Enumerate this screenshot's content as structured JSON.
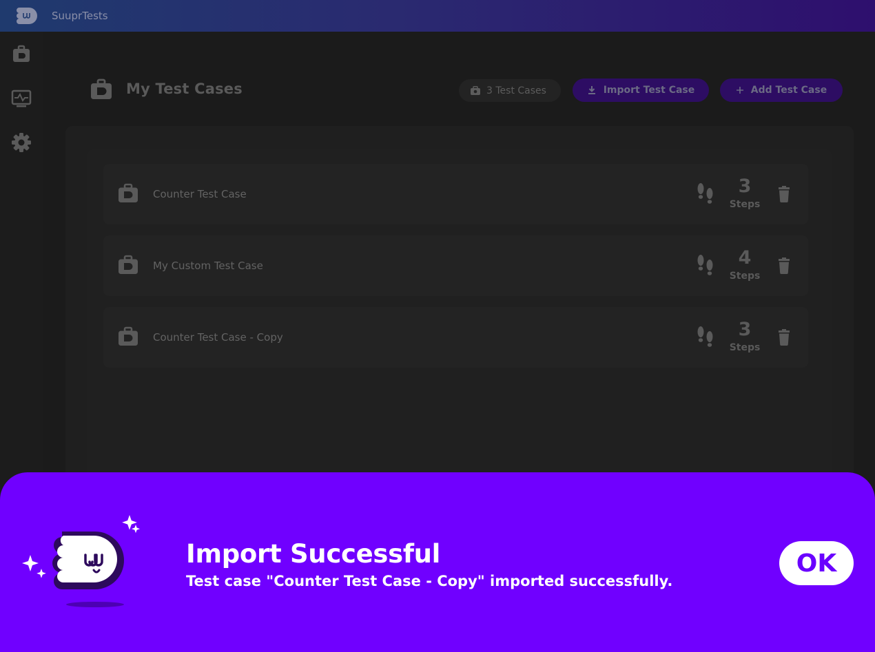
{
  "app": {
    "title": "SuuprTests"
  },
  "sidebar": {
    "items": [
      {
        "icon": "briefcase-icon"
      },
      {
        "icon": "monitor-pulse-icon"
      },
      {
        "icon": "gear-icon"
      }
    ]
  },
  "header": {
    "title": "My Test Cases",
    "count_label": "3 Test Cases",
    "import_label": "Import Test Case",
    "add_label": "Add Test Case"
  },
  "test_cases": [
    {
      "name": "Counter Test Case",
      "steps": "3",
      "steps_label": "Steps"
    },
    {
      "name": "My Custom Test Case",
      "steps": "4",
      "steps_label": "Steps"
    },
    {
      "name": "Counter Test Case - Copy",
      "steps": "3",
      "steps_label": "Steps"
    }
  ],
  "toast": {
    "title": "Import Successful",
    "message": "Test case \"Counter Test Case - Copy\" imported successfully.",
    "ok_label": "OK"
  },
  "colors": {
    "accent": "#7000ff",
    "titlebar_start": "#1f3a6e",
    "titlebar_end": "#2e0f6e",
    "background": "#1b1b1b"
  }
}
